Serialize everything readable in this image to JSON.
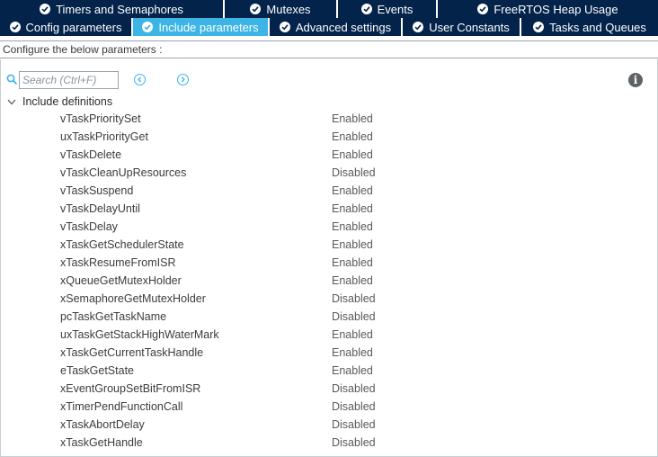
{
  "tabs_row1": [
    {
      "label": "Timers and Semaphores",
      "active": false
    },
    {
      "label": "Mutexes",
      "active": false
    },
    {
      "label": "Events",
      "active": false
    },
    {
      "label": "FreeRTOS Heap Usage",
      "active": false
    }
  ],
  "tabs_row2": [
    {
      "label": "Config parameters",
      "active": false
    },
    {
      "label": "Include parameters",
      "active": true
    },
    {
      "label": "Advanced settings",
      "active": false
    },
    {
      "label": "User Constants",
      "active": false
    },
    {
      "label": "Tasks and Queues",
      "active": false
    }
  ],
  "subtitle": "Configure the below parameters :",
  "search": {
    "placeholder": "Search (Ctrl+F)",
    "value": ""
  },
  "icons": {
    "search": "search-icon",
    "prev": "chevron-left-circle-icon",
    "next": "chevron-right-circle-icon",
    "info": "info-icon",
    "tab_check": "check-circle-icon",
    "expand": "chevron-down-icon"
  },
  "info_glyph": "i",
  "group": {
    "label": "Include definitions",
    "expanded": true
  },
  "params": [
    {
      "name": "vTaskPrioritySet",
      "value": "Enabled"
    },
    {
      "name": "uxTaskPriorityGet",
      "value": "Enabled"
    },
    {
      "name": "vTaskDelete",
      "value": "Enabled"
    },
    {
      "name": "vTaskCleanUpResources",
      "value": "Disabled"
    },
    {
      "name": "vTaskSuspend",
      "value": "Enabled"
    },
    {
      "name": "vTaskDelayUntil",
      "value": "Enabled"
    },
    {
      "name": "vTaskDelay",
      "value": "Enabled"
    },
    {
      "name": "xTaskGetSchedulerState",
      "value": "Enabled"
    },
    {
      "name": "xTaskResumeFromISR",
      "value": "Enabled"
    },
    {
      "name": "xQueueGetMutexHolder",
      "value": "Enabled"
    },
    {
      "name": "xSemaphoreGetMutexHolder",
      "value": "Disabled"
    },
    {
      "name": "pcTaskGetTaskName",
      "value": "Disabled"
    },
    {
      "name": "uxTaskGetStackHighWaterMark",
      "value": "Enabled"
    },
    {
      "name": "xTaskGetCurrentTaskHandle",
      "value": "Enabled"
    },
    {
      "name": "eTaskGetState",
      "value": "Enabled"
    },
    {
      "name": "xEventGroupSetBitFromISR",
      "value": "Disabled"
    },
    {
      "name": "xTimerPendFunctionCall",
      "value": "Disabled"
    },
    {
      "name": "xTaskAbortDelay",
      "value": "Disabled"
    },
    {
      "name": "xTaskGetHandle",
      "value": "Disabled"
    }
  ],
  "colors": {
    "tab_bg": "#03234b",
    "tab_active_bg": "#3cb4e6",
    "accent": "#3cb4e6",
    "text": "#3c3c3c"
  }
}
